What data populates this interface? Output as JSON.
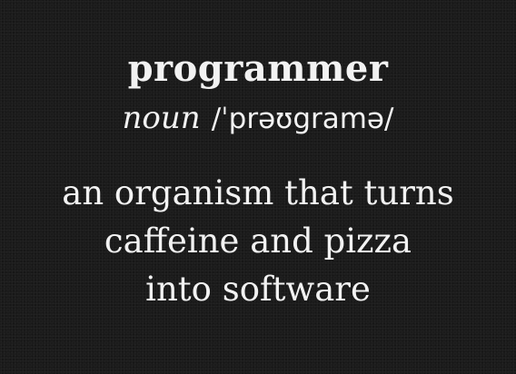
{
  "entry": {
    "word": "programmer",
    "part_of_speech": "noun",
    "pronunciation": "/ˈprəʊgramə/",
    "definition_lines": [
      "an organism that turns",
      "caffeine and pizza",
      "into software"
    ]
  },
  "colors": {
    "background": "#1b1b1b",
    "text": "#f2f2f2"
  }
}
